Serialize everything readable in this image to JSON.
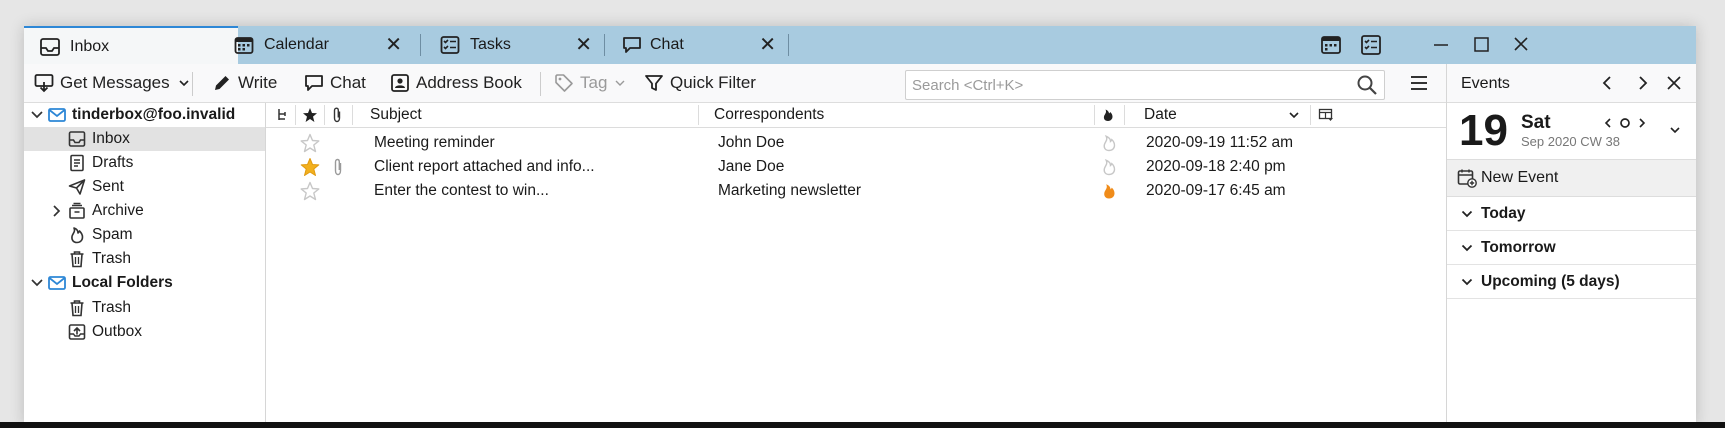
{
  "tabs": [
    {
      "label": "Inbox",
      "icon": "inbox-icon"
    },
    {
      "label": "Calendar",
      "icon": "calendar-icon",
      "close": "✕"
    },
    {
      "label": "Tasks",
      "icon": "tasks-icon",
      "close": "✕"
    },
    {
      "label": "Chat",
      "icon": "chat-icon",
      "close": "✕"
    }
  ],
  "toolbar": {
    "get_messages": "Get Messages",
    "write": "Write",
    "chat": "Chat",
    "address_book": "Address Book",
    "tag": "Tag",
    "quick_filter": "Quick Filter",
    "search_placeholder": "Search <Ctrl+K>"
  },
  "folders": {
    "account": "tinderbox@foo.invalid",
    "items": [
      "Inbox",
      "Drafts",
      "Sent",
      "Archive",
      "Spam",
      "Trash"
    ],
    "local": "Local Folders",
    "local_items": [
      "Trash",
      "Outbox"
    ]
  },
  "columns": {
    "subject": "Subject",
    "correspondents": "Correspondents",
    "date": "Date"
  },
  "messages": [
    {
      "subject": "Meeting reminder",
      "from": "John Doe",
      "date": "2020-09-19 11:52 am",
      "starred": false,
      "attachment": false,
      "junk": false
    },
    {
      "subject": "Client report attached and info...",
      "from": "Jane Doe",
      "date": "2020-09-18 2:40 pm",
      "starred": true,
      "attachment": true,
      "junk": false
    },
    {
      "subject": "Enter the contest to win...",
      "from": "Marketing newsletter",
      "date": "2020-09-17 6:45 am",
      "starred": false,
      "attachment": false,
      "junk": true
    }
  ],
  "today": {
    "title": "Events",
    "day_number": "19",
    "day_name": "Sat",
    "day_sub": "Sep 2020 CW 38",
    "new_event": "New Event",
    "sections": [
      "Today",
      "Tomorrow",
      "Upcoming (5 days)"
    ]
  },
  "colors": {
    "tabbar": "#a8cbe0",
    "accent": "#2d87d6",
    "star": "#f2b01e",
    "junk": "#f08c1a"
  }
}
